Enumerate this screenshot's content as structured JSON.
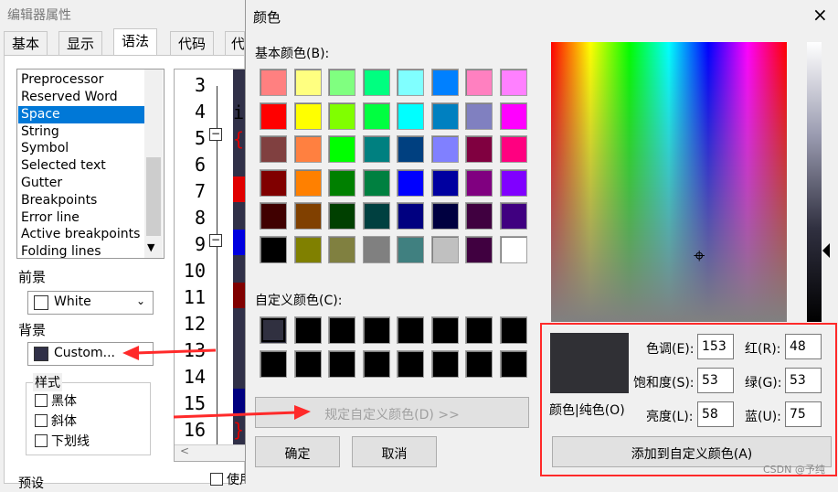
{
  "editor_dialog": {
    "title": "编辑器属性",
    "tabs": [
      "基本",
      "显示",
      "语法",
      "代码",
      "代"
    ],
    "elements": [
      "Preprocessor",
      "Reserved Word",
      "Space",
      "String",
      "Symbol",
      "Selected text",
      "Gutter",
      "Breakpoints",
      "Error line",
      "Active breakpoints",
      "Folding lines"
    ],
    "selected_element": "Space",
    "foreground_label": "前景",
    "foreground_value": "White",
    "background_label": "背景",
    "background_value": "Custom...",
    "style_group": "样式",
    "style_bold": "黑体",
    "style_italic": "斜体",
    "style_underline": "下划线",
    "preset_label": "预设",
    "use_theme": "使用主题设置",
    "line_numbers": [
      "3",
      "4",
      "5",
      "6",
      "7",
      "8",
      "9",
      "10",
      "11",
      "12",
      "13",
      "14",
      "15",
      "16"
    ],
    "code_fragments": [
      "i",
      "{",
      "}"
    ]
  },
  "color_dialog": {
    "title": "颜色",
    "close_icon": "×",
    "basic_colors_label": "基本颜色(B):",
    "basic_colors": [
      "#ff8080",
      "#ffff80",
      "#80ff80",
      "#00ff80",
      "#80ffff",
      "#0080ff",
      "#ff80c0",
      "#ff80ff",
      "#ff0000",
      "#ffff00",
      "#80ff00",
      "#00ff40",
      "#00ffff",
      "#0080c0",
      "#8080c0",
      "#ff00ff",
      "#804040",
      "#ff8040",
      "#00ff00",
      "#008080",
      "#004080",
      "#8080ff",
      "#800040",
      "#ff0080",
      "#800000",
      "#ff8000",
      "#008000",
      "#008040",
      "#0000ff",
      "#0000a0",
      "#800080",
      "#8000ff",
      "#400000",
      "#804000",
      "#004000",
      "#004040",
      "#000080",
      "#000040",
      "#400040",
      "#400080",
      "#000000",
      "#808000",
      "#808040",
      "#808080",
      "#408080",
      "#c0c0c0",
      "#400040",
      "#ffffff"
    ],
    "custom_colors_label": "自定义颜色(C):",
    "custom_colors": [
      "#303040",
      "#000000",
      "#000000",
      "#000000",
      "#000000",
      "#000000",
      "#000000",
      "#000000",
      "#000000",
      "#000000",
      "#000000",
      "#000000",
      "#000000",
      "#000000",
      "#000000",
      "#000000"
    ],
    "define_custom_button": "规定自定义颜色(D) >>",
    "ok_button": "确定",
    "cancel_button": "取消",
    "preview_label": "颜色|纯色(O)",
    "preview_color": "#303035",
    "hue_label": "色调(E):",
    "hue_value": "153",
    "sat_label": "饱和度(S):",
    "sat_value": "53",
    "lum_label": "亮度(L):",
    "lum_value": "58",
    "red_label": "红(R):",
    "red_value": "48",
    "green_label": "绿(G):",
    "green_value": "53",
    "blue_label": "蓝(U):",
    "blue_value": "75",
    "add_custom_button": "添加到自定义颜色(A)"
  },
  "watermark": "CSDN @予纯",
  "annotation_color": "#ff2a2a"
}
